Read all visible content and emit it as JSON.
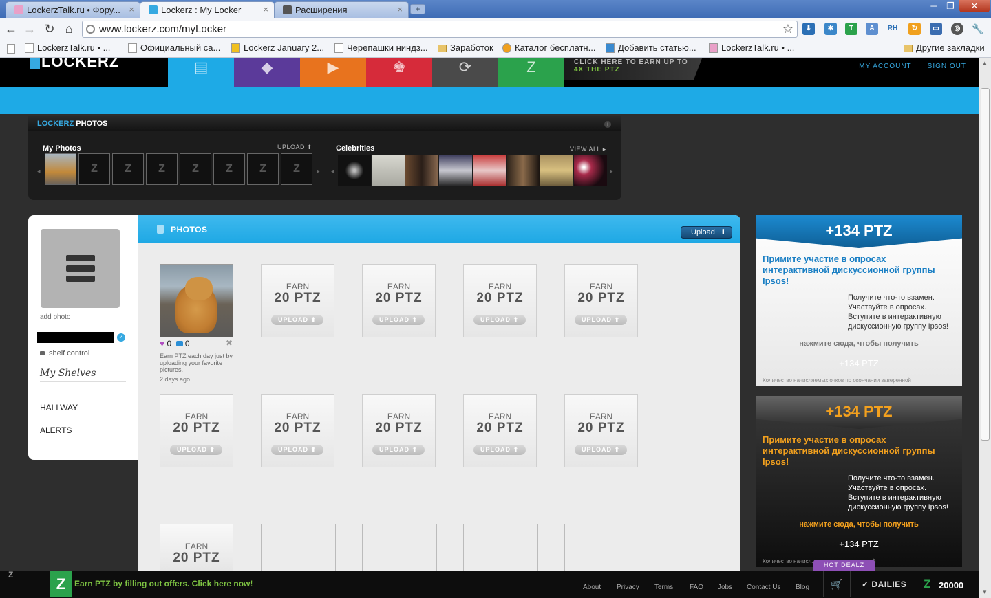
{
  "browser": {
    "tabs": [
      {
        "title": "LockerzTalk.ru • Фору..."
      },
      {
        "title": "Lockerz : My Locker"
      },
      {
        "title": "Расширения"
      }
    ],
    "new_tab_icon": "+",
    "close_icon": "×",
    "url": "www.lockerz.com/myLocker",
    "bookmarks": [
      {
        "label": "LockerzTalk.ru • ..."
      },
      {
        "label": "Официальный са..."
      },
      {
        "label": "Lockerz January 2..."
      },
      {
        "label": "Черепашки ниндз..."
      },
      {
        "label": "Заработок"
      },
      {
        "label": "Каталог бесплатн..."
      },
      {
        "label": "Добавить статью..."
      },
      {
        "label": "LockerzTalk.ru • ..."
      }
    ],
    "other_bookmarks": "Другие закладки"
  },
  "header": {
    "logo": "LOCKERZ",
    "promo_line1": "CLICK HERE TO EARN UP TO",
    "promo_line2": "4X THE PTZ",
    "my_account": "MY ACCOUNT",
    "separator": "|",
    "sign_out": "SIGN OUT",
    "nav_glyphs": [
      "▤",
      "◆",
      "▶",
      "♚",
      "⟳",
      "Z"
    ]
  },
  "photos_panel": {
    "title_brand": "LOCKERZ",
    "title": "PHOTOS",
    "info_icon": "i",
    "my_photos": "My Photos",
    "upload": "UPLOAD",
    "celebrities": "Celebrities",
    "view_all": "VIEW ALL",
    "empty_thumb_glyph": "Z"
  },
  "profile": {
    "add_photo": "add photo",
    "shelf_control": "shelf control",
    "my_shelves": "My Shelves",
    "links": [
      "HALLWAY",
      "ALERTS"
    ]
  },
  "main": {
    "title": "PHOTOS",
    "upload_button": "Upload",
    "slot_earn": "EARN",
    "slot_ptz": "20 PTZ",
    "slot_upload": "UPLOAD",
    "photo_likes": "0",
    "photo_comments": "0",
    "photo_caption": "Earn PTZ each day just by uploading your favorite pictures.",
    "photo_date": "2 days ago"
  },
  "ads": [
    {
      "ptz": "+134 PTZ",
      "title": "Примите участие в опросах интерактивной дискуссионной группы Ipsos!",
      "body": "Получите что-то взамен. Участвуйте в опросах. Вступите в интерактивную дискуссионную группу Ipsos!",
      "cta": "нажмите сюда, чтобы получить",
      "ptz_small": "+134 PTZ",
      "foot": "Количество начисляемых очков по окончании заверенной"
    },
    {
      "ptz": "+134 PTZ",
      "title": "Примите участие в опросах интерактивной дискуссионной группы Ipsos!",
      "body": "Получите что-то взамен. Участвуйте в опросах. Вступите в интерактивную дискуссионную группу Ipsos!",
      "cta": "нажмите сюда, чтобы получить",
      "ptz_small": "+134 PTZ",
      "foot": "Количество начисл... окончании заверенной"
    }
  ],
  "hot_dealz": "HOT DEALZ",
  "footer": {
    "cta": "Earn PTZ by filling out offers. Click here now!",
    "links": [
      "About",
      "Privacy",
      "Terms",
      "FAQ",
      "Jobs",
      "Contact Us",
      "Blog"
    ],
    "dailies": "DAILIES",
    "ptz_balance": "20000"
  },
  "colors": {
    "accent_blue": "#1eaae6",
    "brand_green": "#2ba24c",
    "hot_dealz_purple": "#8d4fb5",
    "ad_orange": "#f2a01e"
  }
}
